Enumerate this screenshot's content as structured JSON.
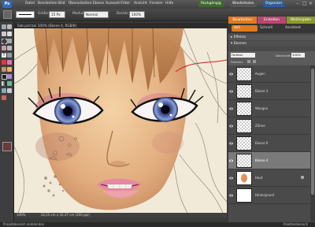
{
  "app": {
    "logo": "Ps",
    "accent": "#e07a1f"
  },
  "menu": [
    "Datei",
    "Bearbeiten",
    "Bild",
    "Überarbeiten",
    "Ebene",
    "Auswahl",
    "Filter",
    "Ansicht",
    "Fenster",
    "Hilfe"
  ],
  "top_buttons": {
    "undo": "Rückgängig",
    "redo": "Wiederholen",
    "organizer": "Organizer"
  },
  "options": {
    "size_label": "Größe:",
    "size_value": "15 Px",
    "mode_label": "Modus:",
    "mode_value": "Normal",
    "opacity_label": "Deckkr.:",
    "opacity_value": "100%"
  },
  "document": {
    "title": "Sab.psd bei 100% (Ebene 4, RGB/8)"
  },
  "status": {
    "zoom": "100%",
    "info": "14,55 cm x 16,37 cm (200 ppi)"
  },
  "bottom": {
    "left": "Projektbereich einblenden",
    "right": "Palettenbereich"
  },
  "panel": {
    "tabs": [
      "Bearbeiten",
      "Erstellen",
      "Weitergabe"
    ],
    "subtabs": [
      "Voll",
      "Schnell",
      "Assistent"
    ],
    "sections": {
      "effects": "Effekte",
      "layers": "Ebenen"
    },
    "blend_mode": "Farbton",
    "opacity_label": "Deckkraft:",
    "opacity_value": "100%",
    "lock_label": "Fixieren:",
    "layers": [
      {
        "name": "Augen",
        "thumb": "checker"
      },
      {
        "name": "Ebene 3",
        "thumb": "checker"
      },
      {
        "name": "Wangen",
        "thumb": "checker"
      },
      {
        "name": "Zähne",
        "thumb": "checker"
      },
      {
        "name": "Ebene 6",
        "thumb": "checker"
      },
      {
        "name": "Ebene 4",
        "thumb": "checker",
        "selected": true
      },
      {
        "name": "Haut",
        "thumb": "skin"
      },
      {
        "name": "Hintergrund",
        "thumb": "white"
      }
    ]
  }
}
